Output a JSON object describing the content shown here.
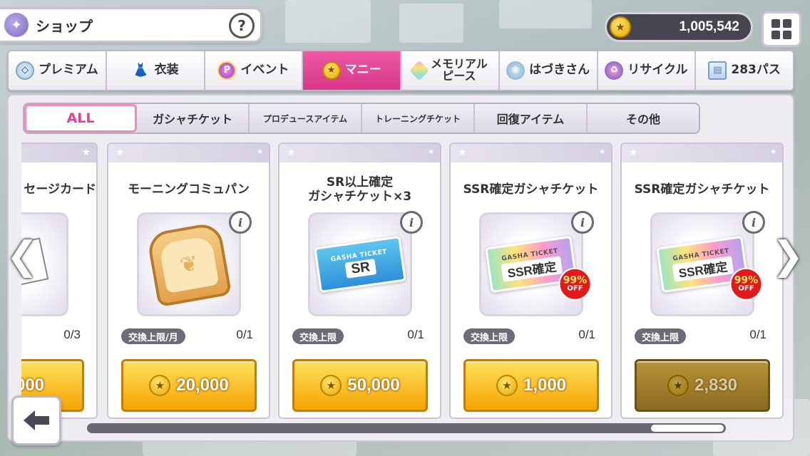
{
  "header": {
    "title": "ショップ",
    "help_label": "?",
    "money": "1,005,542"
  },
  "main_tabs": [
    {
      "label": "プレミアム",
      "icon": "gem-icon",
      "active": false
    },
    {
      "label": "衣装",
      "icon": "dress-icon",
      "active": false
    },
    {
      "label": "イベント",
      "icon": "p-coin-icon",
      "active": false
    },
    {
      "label": "マニー",
      "icon": "money-coin-icon",
      "active": true
    },
    {
      "label": "メモリアル\nピース",
      "icon": "prism-icon",
      "active": false
    },
    {
      "label": "はづきさん",
      "icon": "hazuki-icon",
      "active": false
    },
    {
      "label": "リサイクル",
      "icon": "recycle-icon",
      "active": false
    },
    {
      "label": "283パス",
      "icon": "pass-icon",
      "active": false
    }
  ],
  "sub_tabs": [
    {
      "label": "ALL",
      "active": true
    },
    {
      "label": "ガシャチケット",
      "active": false
    },
    {
      "label": "プロデュースアイテム",
      "active": false
    },
    {
      "label": "トレーニングチケット",
      "active": false
    },
    {
      "label": "回復アイテム",
      "active": false
    },
    {
      "label": "その他",
      "active": false
    }
  ],
  "cards": [
    {
      "name": "セージカード",
      "limit": "",
      "count": "0/3",
      "price": "000",
      "item": "message-card-icon",
      "enabled": true
    },
    {
      "name": "モーニングコミュパン",
      "limit": "交換上限/月",
      "count": "0/1",
      "price": "20,000",
      "item": "bread-icon",
      "enabled": true
    },
    {
      "name": "SR以上確定\nガシャチケット×3",
      "limit": "交換上限",
      "count": "0/1",
      "price": "50,000",
      "item": "sr-ticket-icon",
      "ticket_top": "GASHA TICKET",
      "ticket_main": "SR",
      "enabled": true
    },
    {
      "name": "SSR確定ガシャチケット",
      "limit": "交換上限",
      "count": "0/1",
      "price": "1,000",
      "item": "ssr-ticket-icon",
      "ticket_top": "GASHA TICKET",
      "ticket_main": "SSR確定",
      "badge_pct": "99%",
      "badge_off": "OFF",
      "enabled": true
    },
    {
      "name": "SSR確定ガシャチケット",
      "limit": "交換上限",
      "count": "0/1",
      "price": "2,830",
      "item": "ssr-ticket-icon",
      "ticket_top": "GASHA TICKET",
      "ticket_main": "SSR確定",
      "badge_pct": "99%",
      "badge_off": "OFF",
      "enabled": false
    }
  ],
  "colors": {
    "accent_pink": "#e8408f",
    "price_gold": "#f5a400",
    "price_disabled": "#8a6a1f"
  }
}
